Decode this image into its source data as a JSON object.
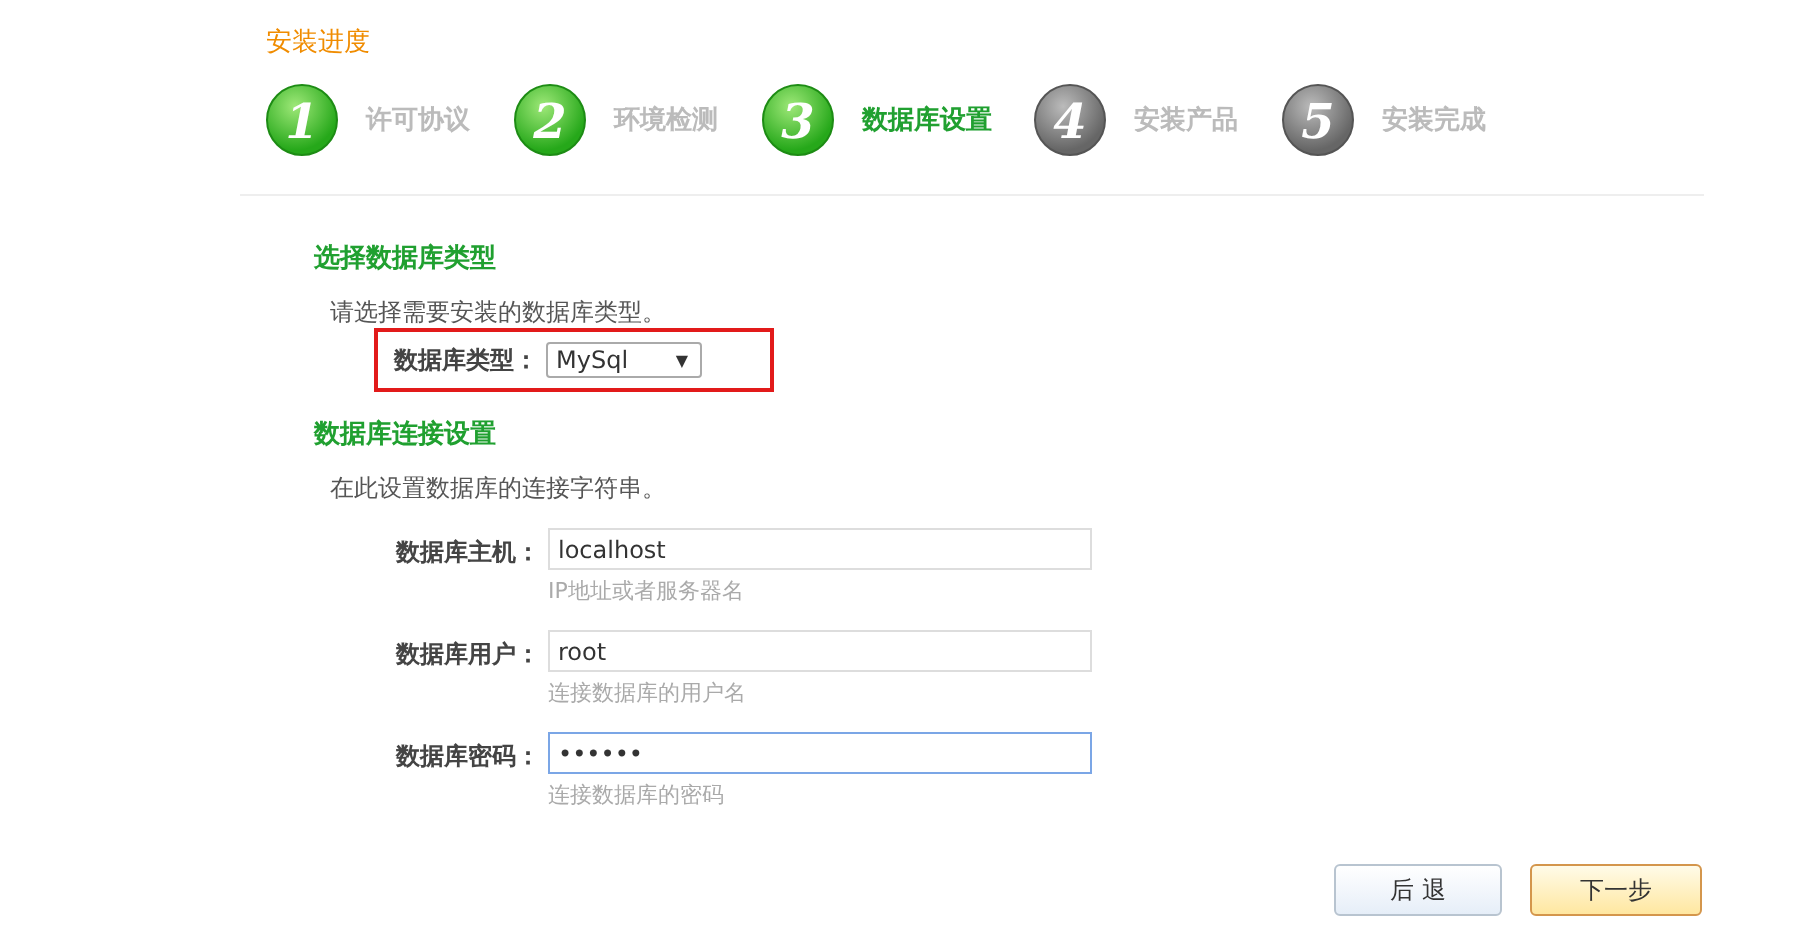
{
  "title": "安装进度",
  "steps": [
    {
      "number": "1",
      "label": "许可协议",
      "done": true,
      "selected": false
    },
    {
      "number": "2",
      "label": "环境检测",
      "done": true,
      "selected": false
    },
    {
      "number": "3",
      "label": "数据库设置",
      "done": true,
      "selected": true
    },
    {
      "number": "4",
      "label": "安装产品",
      "done": false,
      "selected": false
    },
    {
      "number": "5",
      "label": "安装完成",
      "done": false,
      "selected": false
    }
  ],
  "db_type_section": {
    "heading": "选择数据库类型",
    "description": "请选择需要安装的数据库类型。",
    "label": "数据库类型：",
    "value": "MySql",
    "caret": "▼",
    "highlighted": true
  },
  "connection_section": {
    "heading": "数据库连接设置",
    "description": "在此设置数据库的连接字符串。",
    "fields": [
      {
        "label": "数据库主机：",
        "value": "localhost",
        "hint": "IP地址或者服务器名",
        "focused": false
      },
      {
        "label": "数据库用户：",
        "value": "root",
        "hint": "连接数据库的用户名",
        "focused": false
      },
      {
        "label": "数据库密码：",
        "value": "••••••",
        "hint": "连接数据库的密码",
        "focused": true
      }
    ]
  },
  "buttons": [
    {
      "label": "后 退",
      "kind": "secondary"
    },
    {
      "label": "下一步",
      "kind": "primary"
    }
  ]
}
